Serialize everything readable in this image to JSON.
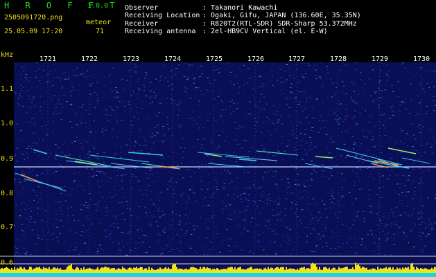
{
  "header": {
    "app_name": "H R O F F T",
    "version": "1.0.0",
    "file_name": "2505091720.png",
    "category": "meteor",
    "date_time": "25.05.09 17:20",
    "count": "71",
    "fields": [
      {
        "label": "Observer",
        "value": ": Takanori Kawachi"
      },
      {
        "label": "Receiving Location",
        "value": ": Ogaki, Gifu, JAPAN (136.60E, 35.35N)"
      },
      {
        "label": "Receiver",
        "value": ": R820T2(RTL-SDR) SDR-Sharp 53.372MHz"
      },
      {
        "label": "Receiving antenna",
        "value": ": 2el-HB9CV Vertical (el. E-W)"
      }
    ]
  },
  "axis": {
    "unit": "kHz",
    "y_ticks": [
      "1.1",
      "1.0",
      "0.9",
      "0.8",
      "0.7",
      "0.6"
    ],
    "x_ticks": [
      "1721",
      "1722",
      "1723",
      "1724",
      "1725",
      "1726",
      "1727",
      "1728",
      "1729",
      "1730"
    ]
  },
  "colors": {
    "background": "#000000",
    "noise": "#1a2aa8",
    "carrier": "#c8d8ff",
    "meteor": "#38e0ff",
    "label_yellow": "#f0e21a",
    "label_green": "#19e619"
  }
}
